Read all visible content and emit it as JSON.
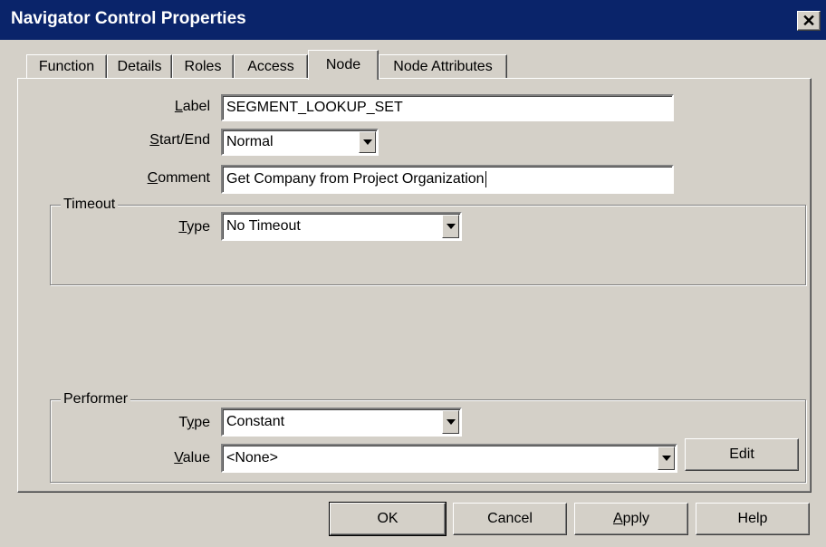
{
  "window": {
    "title": "Navigator Control Properties",
    "close_glyph": "✕"
  },
  "tabs": [
    {
      "label": "Function"
    },
    {
      "label": "Details"
    },
    {
      "label": "Roles"
    },
    {
      "label": "Access"
    },
    {
      "label": "Node",
      "active": true
    },
    {
      "label": "Node Attributes"
    }
  ],
  "node": {
    "label_caption": "Label",
    "label_value": "SEGMENT_LOOKUP_SET",
    "startend_caption": "Start/End",
    "startend_value": "Normal",
    "comment_caption": "Comment",
    "comment_value": "Get Company from Project Organization"
  },
  "timeout": {
    "legend": "Timeout",
    "type_caption": "Type",
    "type_value": "No Timeout"
  },
  "performer": {
    "legend": "Performer",
    "type_caption": "Type",
    "type_value": "Constant",
    "value_caption": "Value",
    "value_value": "<None>",
    "edit_label": "Edit"
  },
  "buttons": {
    "ok": "OK",
    "cancel": "Cancel",
    "apply": "Apply",
    "help": "Help"
  },
  "colors": {
    "titlebar": "#0a246a",
    "face": "#d4d0c8",
    "field": "#ffffff"
  }
}
